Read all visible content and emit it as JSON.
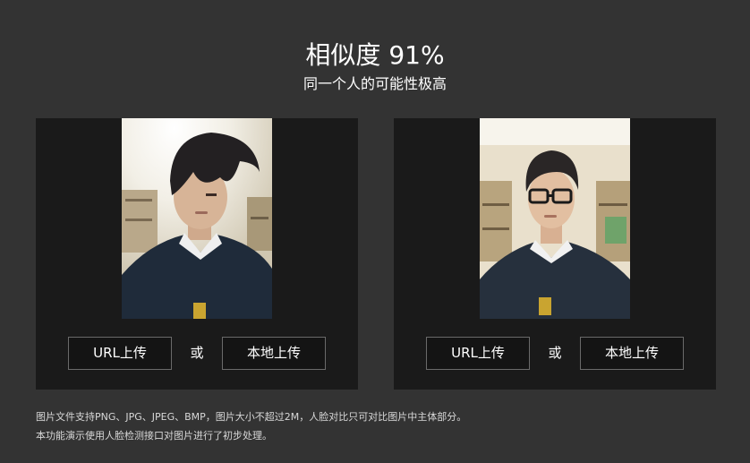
{
  "result": {
    "score_text": "相似度 91%",
    "verdict": "同一个人的可能性极高"
  },
  "panels": [
    {
      "photo_name": "face-photo-1",
      "url_upload_label": "URL上传",
      "or_label": "或",
      "local_upload_label": "本地上传"
    },
    {
      "photo_name": "face-photo-2",
      "url_upload_label": "URL上传",
      "or_label": "或",
      "local_upload_label": "本地上传"
    }
  ],
  "notes": {
    "line1": "图片文件支持PNG、JPG、JPEG、BMP，图片大小不超过2M，人脸对比只可对比图片中主体部分。",
    "line2": "本功能演示使用人脸检测接口对图片进行了初步处理。"
  },
  "colors": {
    "page_bg": "#333333",
    "panel_bg": "#1a1a1a",
    "button_border": "#6a6a6a",
    "text": "#ffffff",
    "note_text": "#d8d8d8"
  }
}
